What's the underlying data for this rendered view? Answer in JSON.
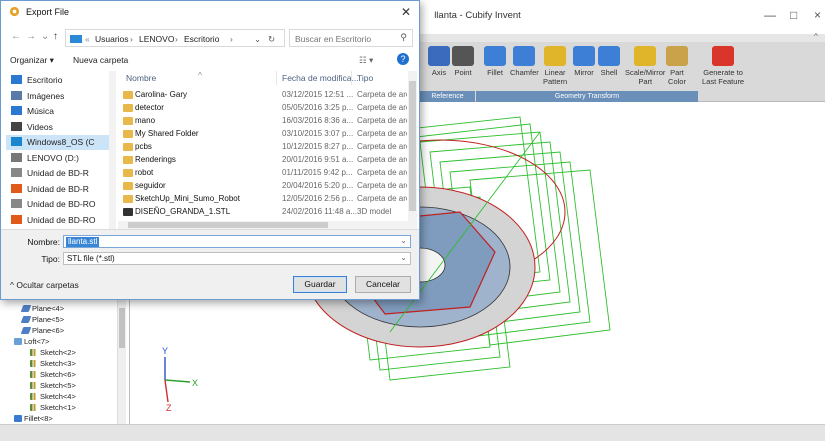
{
  "app": {
    "title": "llanta - Cubify Invent",
    "ribbon_buttons": [
      "Axis",
      "Point",
      "Fillet",
      "Chamfer",
      "Linear\nPattern",
      "Mirror",
      "Shell",
      "Scale/Mirror\nPart",
      "Part\nColor",
      "Generate to\nLast Feature"
    ],
    "ribbon_groups": [
      "Reference",
      "Geometry Transform"
    ],
    "tree_items": [
      "Plane<4>",
      "Plane<5>",
      "Plane<6>",
      "Loft<7>",
      "Sketch<2>",
      "Sketch<3>",
      "Sketch<6>",
      "Sketch<5>",
      "Sketch<4>",
      "Sketch<1>",
      "Fillet<8>"
    ],
    "axes": {
      "x": "X",
      "y": "Y",
      "z": "Z"
    },
    "axis_colors": {
      "x": "#2aa12a",
      "y": "#2a4fd0",
      "z": "#d03030"
    }
  },
  "dialog": {
    "title": "Export File",
    "breadcrumbs": [
      "Usuarios",
      "LENOVO",
      "Escritorio"
    ],
    "search_placeholder": "Buscar en Escritorio",
    "commands": {
      "organize": "Organizar ▾",
      "new_folder": "Nueva carpeta"
    },
    "nav_items": [
      "Escritorio",
      "Imágenes",
      "Música",
      "Videos",
      "Windows8_OS (C",
      "LENOVO (D:)",
      "Unidad de BD-R",
      "Unidad de BD-R",
      "Unidad de BD-RO",
      "Unidad de BD-RO"
    ],
    "columns": {
      "name": "Nombre",
      "date": "Fecha de modifica...",
      "type": "Tipo"
    },
    "files": [
      {
        "name": "Carolina- Gary",
        "date": "03/12/2015 12:51 ...",
        "type": "Carpeta de archiv"
      },
      {
        "name": "detector",
        "date": "05/05/2016 3:25 p...",
        "type": "Carpeta de archiv"
      },
      {
        "name": "mano",
        "date": "16/03/2016 8:36 a...",
        "type": "Carpeta de archiv"
      },
      {
        "name": "My Shared Folder",
        "date": "03/10/2015 3:07 p...",
        "type": "Carpeta de archiv"
      },
      {
        "name": "pcbs",
        "date": "10/12/2015 8:27 p...",
        "type": "Carpeta de archiv"
      },
      {
        "name": "Renderings",
        "date": "20/01/2016 9:51 a...",
        "type": "Carpeta de archiv"
      },
      {
        "name": "robot",
        "date": "01/11/2015 9:42 p...",
        "type": "Carpeta de archiv"
      },
      {
        "name": "seguidor",
        "date": "20/04/2016 5:20 p...",
        "type": "Carpeta de archiv"
      },
      {
        "name": "SketchUp_Mini_Sumo_Robot",
        "date": "12/05/2016 2:56 p...",
        "type": "Carpeta de archiv"
      },
      {
        "name": "DISEÑO_GRANDA_1.STL",
        "date": "24/02/2016 11:48 a...",
        "type": "3D model"
      }
    ],
    "filename_label": "Nombre:",
    "filename_value": "llanta.stl",
    "filetype_label": "Tipo:",
    "filetype_value": "STL file (*.stl)",
    "hide_folders": "Ocultar carpetas",
    "save_label": "Guardar",
    "cancel_label": "Cancelar"
  }
}
